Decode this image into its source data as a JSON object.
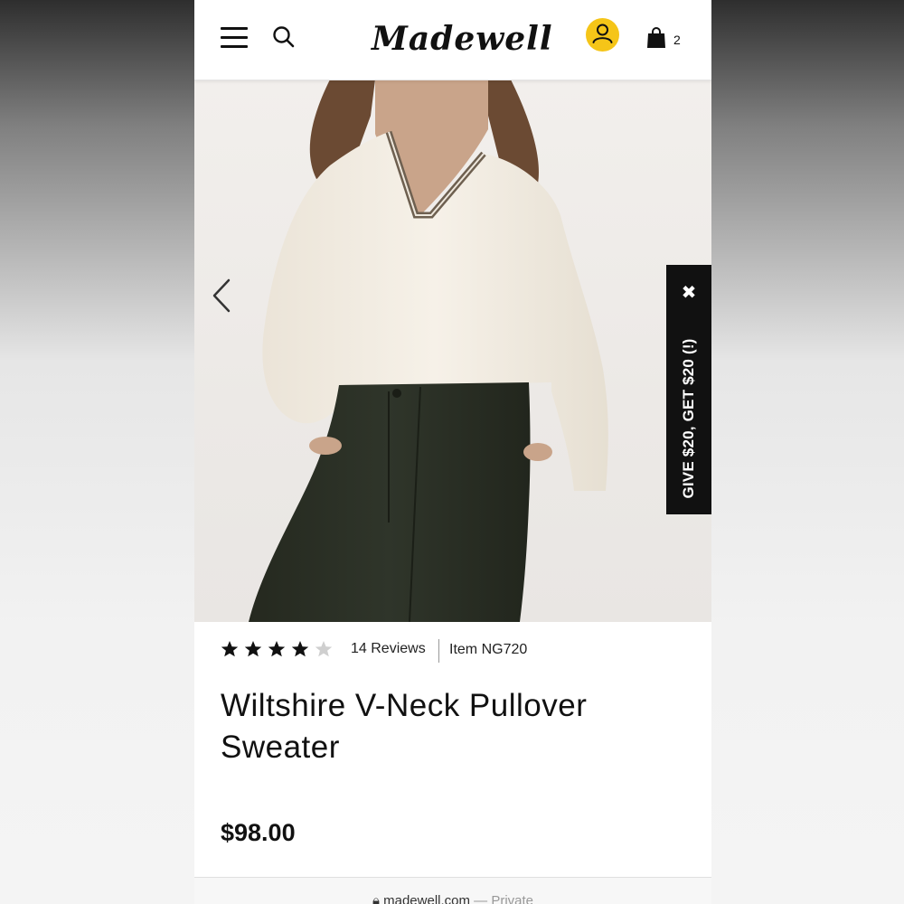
{
  "header": {
    "brand": "Madewell",
    "bag_count": "2",
    "icons": {
      "menu": "hamburger-menu-icon",
      "search": "search-icon",
      "account": "account-icon",
      "bag": "shopping-bag-icon"
    },
    "account_color": "#f5c518"
  },
  "hero": {
    "promo_close": "✖",
    "promo_text": "GIVE $20, GET $20 (!)",
    "prev_icon": "chevron-left-icon"
  },
  "product": {
    "rating": 4,
    "rating_max": 5,
    "reviews": "14 Reviews",
    "item_number": "Item NG720",
    "title": "Wiltshire V-Neck Pullover Sweater",
    "price": "$98.00"
  },
  "browser": {
    "domain": "madewell.com",
    "separator": " — ",
    "mode": "Private"
  }
}
